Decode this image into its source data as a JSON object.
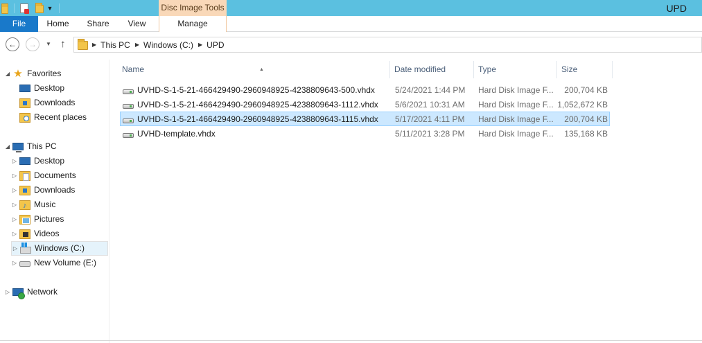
{
  "window": {
    "title": "UPD",
    "context_tab_group": "Disc Image Tools"
  },
  "ribbon": {
    "tabs": [
      "File",
      "Home",
      "Share",
      "View",
      "Manage"
    ]
  },
  "address": {
    "crumbs": [
      "This PC",
      "Windows (C:)",
      "UPD"
    ]
  },
  "sidebar": {
    "favorites": {
      "label": "Favorites",
      "items": [
        "Desktop",
        "Downloads",
        "Recent places"
      ]
    },
    "this_pc": {
      "label": "This PC",
      "items": [
        "Desktop",
        "Documents",
        "Downloads",
        "Music",
        "Pictures",
        "Videos",
        "Windows (C:)",
        "New Volume (E:)"
      ],
      "selected": "Windows (C:)"
    },
    "network": {
      "label": "Network"
    }
  },
  "filelist": {
    "columns": [
      "Name",
      "Date modified",
      "Type",
      "Size"
    ],
    "files": [
      {
        "name": "UVHD-S-1-5-21-466429490-2960948925-4238809643-500.vhdx",
        "date": "5/24/2021 1:44 PM",
        "type": "Hard Disk Image F...",
        "size": "200,704 KB"
      },
      {
        "name": "UVHD-S-1-5-21-466429490-2960948925-4238809643-1112.vhdx",
        "date": "5/6/2021 10:31 AM",
        "type": "Hard Disk Image F...",
        "size": "1,052,672 KB"
      },
      {
        "name": "UVHD-S-1-5-21-466429490-2960948925-4238809643-1115.vhdx",
        "date": "5/17/2021 4:11 PM",
        "type": "Hard Disk Image F...",
        "size": "200,704 KB"
      },
      {
        "name": "UVHD-template.vhdx",
        "date": "5/11/2021 3:28 PM",
        "type": "Hard Disk Image F...",
        "size": "135,168 KB"
      }
    ],
    "selected_index": 2
  },
  "colors": {
    "titlebar": "#5bc0e0",
    "file_tab": "#1979ca",
    "context_tab": "#f9d8b8",
    "selection": "#cce8ff"
  }
}
